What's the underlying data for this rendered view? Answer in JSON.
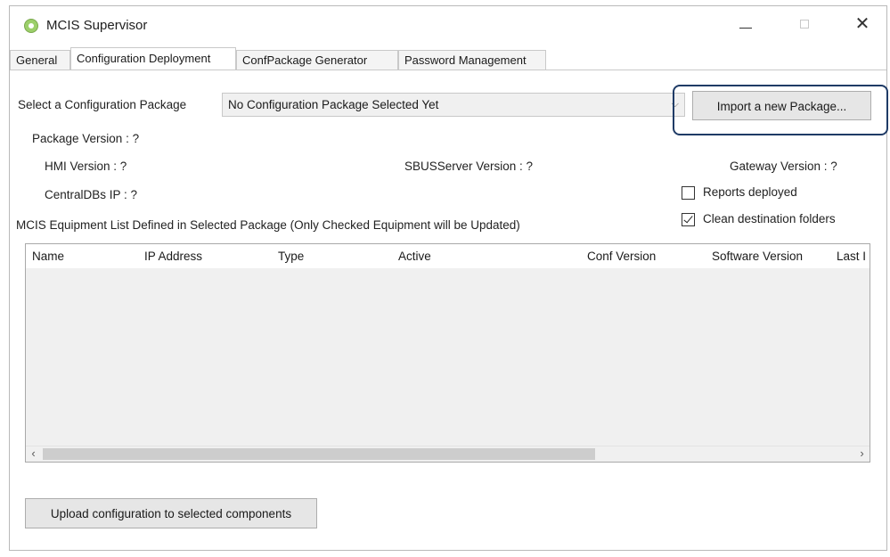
{
  "window": {
    "title": "MCIS Supervisor"
  },
  "tabs": [
    {
      "label": "General"
    },
    {
      "label": "Configuration Deployment"
    },
    {
      "label": "ConfPackage Generator"
    },
    {
      "label": "Password Management"
    }
  ],
  "deployment": {
    "select_label": "Select a Configuration Package",
    "package_value": "No Configuration Package Selected Yet",
    "import_button": "Import a new Package...",
    "package_version": "Package Version : ?",
    "hmi_version": "HMI Version : ?",
    "sbus_version": "SBUSServer Version : ?",
    "gateway_version": "Gateway Version : ?",
    "centraldbs_ip": "CentralDBs IP : ?",
    "reports_deployed": {
      "label": "Reports deployed",
      "checked": false
    },
    "clean_folders": {
      "label": "Clean destination folders",
      "checked": true
    },
    "equipment_list_label": "MCIS Equipment List Defined in Selected Package (Only Checked Equipment will be Updated)",
    "columns": [
      "Name",
      "IP Address",
      "Type",
      "Active",
      "Conf Version",
      "Software Version",
      "Last I"
    ],
    "upload_button": "Upload configuration to selected components"
  },
  "colors": {
    "highlight_border": "#1f3b66",
    "button_bg": "#e6e6e6",
    "list_bg": "#f0f0f0"
  }
}
